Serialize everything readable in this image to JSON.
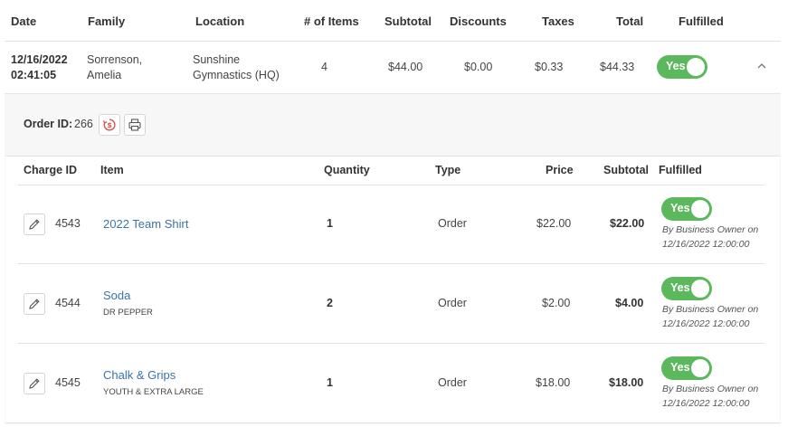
{
  "orders_table": {
    "headers": {
      "date": "Date",
      "family": "Family",
      "location": "Location",
      "items": "# of Items",
      "subtotal": "Subtotal",
      "discounts": "Discounts",
      "taxes": "Taxes",
      "total": "Total",
      "fulfilled": "Fulfilled"
    },
    "row": {
      "date_line1": "12/16/2022",
      "date_line2": "02:41:05",
      "family_line1": "Sorrenson,",
      "family_line2": "Amelia",
      "location_line1": "Sunshine",
      "location_line2": "Gymnastics (HQ)",
      "items": "4",
      "subtotal": "$44.00",
      "discounts": "$0.00",
      "taxes": "$0.33",
      "total": "$44.33",
      "fulfilled": "Yes"
    }
  },
  "order_detail": {
    "order_id_label": "Order ID:",
    "order_id_value": "266",
    "headers": {
      "charge_id": "Charge ID",
      "item": "Item",
      "quantity": "Quantity",
      "type": "Type",
      "price": "Price",
      "subtotal": "Subtotal",
      "fulfilled": "Fulfilled"
    },
    "charges": [
      {
        "charge_id": "4543",
        "item": "2022 Team Shirt",
        "sub": "",
        "quantity": "1",
        "type": "Order",
        "price": "$22.00",
        "subtotal": "$22.00",
        "fulfilled": "Yes",
        "by_line1": "By Business Owner on",
        "by_line2": "12/16/2022 12:00:00"
      },
      {
        "charge_id": "4544",
        "item": "Soda",
        "sub": "DR PEPPER",
        "quantity": "2",
        "type": "Order",
        "price": "$2.00",
        "subtotal": "$4.00",
        "fulfilled": "Yes",
        "by_line1": "By Business Owner on",
        "by_line2": "12/16/2022 12:00:00"
      },
      {
        "charge_id": "4545",
        "item": "Chalk & Grips",
        "sub": "YOUTH & EXTRA LARGE",
        "quantity": "1",
        "type": "Order",
        "price": "$18.00",
        "subtotal": "$18.00",
        "fulfilled": "Yes",
        "by_line1": "By Business Owner on",
        "by_line2": "12/16/2022 12:00:00"
      }
    ]
  },
  "icons": {
    "collapse": "chevron-up-icon",
    "refund": "refund-dollar-icon",
    "print": "printer-icon",
    "edit": "pencil-icon"
  },
  "colors": {
    "toggle_on": "#5cb85c",
    "link": "#3b73a8",
    "refund_icon": "#d9534f",
    "detail_bg": "#f7f7f7"
  }
}
